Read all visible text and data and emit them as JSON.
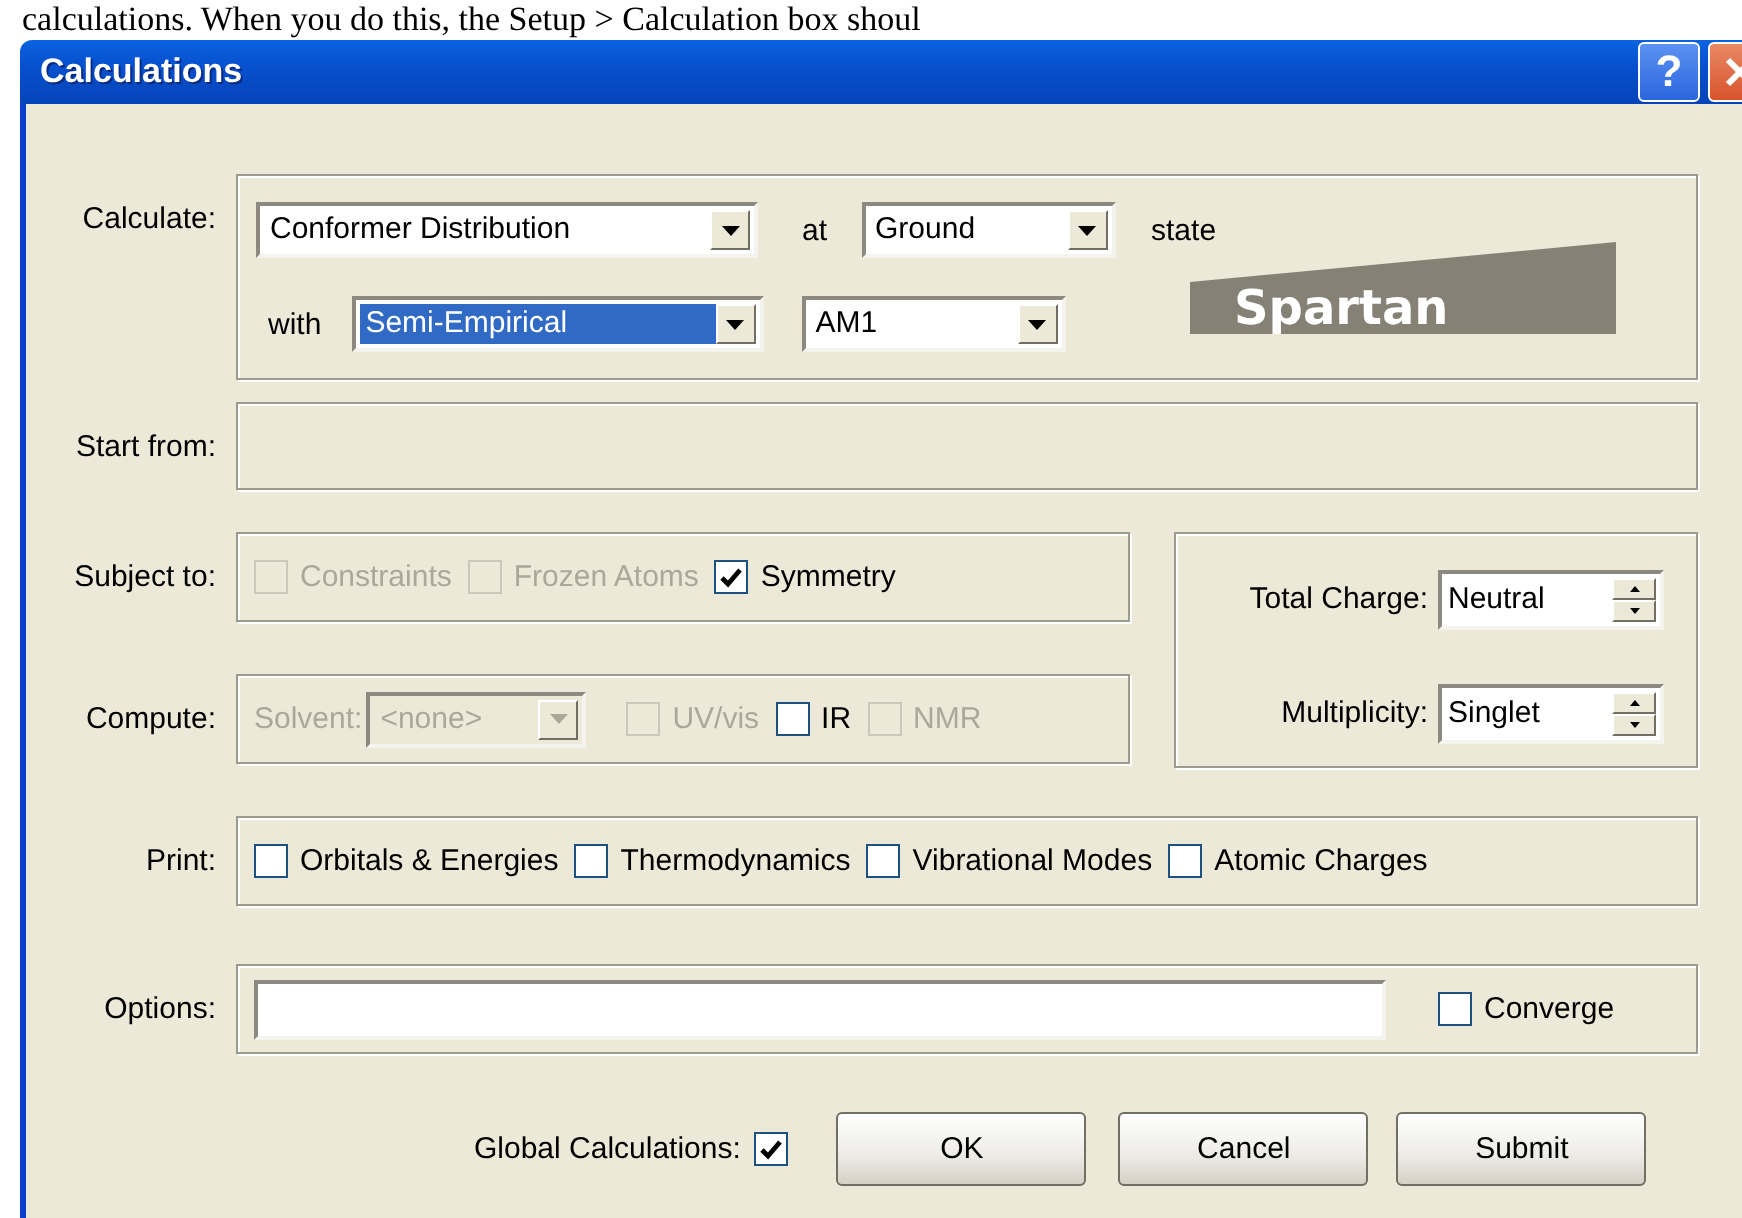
{
  "document_text": "calculations.  When you do this, the Setup > Calculation box shoul",
  "window": {
    "title": "Calculations",
    "help_label": "?"
  },
  "calculate": {
    "label": "Calculate:",
    "task": "Conformer Distribution",
    "at_label": "at",
    "state_value": "Ground",
    "state_label": "state",
    "with_label": "with",
    "method": {
      "value": "Semi-Empirical",
      "selected": true
    },
    "model": "AM1",
    "logo": "Spartan"
  },
  "start_from": {
    "label": "Start from:"
  },
  "subject_to": {
    "label": "Subject to:",
    "options": [
      {
        "label": "Constraints",
        "checked": false,
        "disabled": true
      },
      {
        "label": "Frozen Atoms",
        "checked": false,
        "disabled": true
      },
      {
        "label": "Symmetry",
        "checked": true,
        "disabled": false
      }
    ]
  },
  "compute": {
    "label": "Compute:",
    "solvent_label": "Solvent:",
    "solvent": "<none>",
    "solvent_disabled": true,
    "options": [
      {
        "label": "UV/vis",
        "checked": false,
        "disabled": true
      },
      {
        "label": "IR",
        "checked": false,
        "disabled": false
      },
      {
        "label": "NMR",
        "checked": false,
        "disabled": true
      }
    ]
  },
  "total_charge": {
    "label": "Total Charge:",
    "value": "Neutral"
  },
  "multiplicity": {
    "label": "Multiplicity:",
    "value": "Singlet"
  },
  "print": {
    "label": "Print:",
    "options": [
      {
        "label": "Orbitals & Energies",
        "checked": false,
        "disabled": false
      },
      {
        "label": "Thermodynamics",
        "checked": false,
        "disabled": false
      },
      {
        "label": "Vibrational Modes",
        "checked": false,
        "disabled": false
      },
      {
        "label": "Atomic Charges",
        "checked": false,
        "disabled": false
      }
    ]
  },
  "options": {
    "label": "Options:",
    "converge": {
      "label": "Converge",
      "checked": false,
      "disabled": false
    }
  },
  "global_calculations": {
    "label": "Global Calculations:",
    "checked": true
  },
  "buttons": [
    "OK",
    "Cancel",
    "Submit"
  ]
}
